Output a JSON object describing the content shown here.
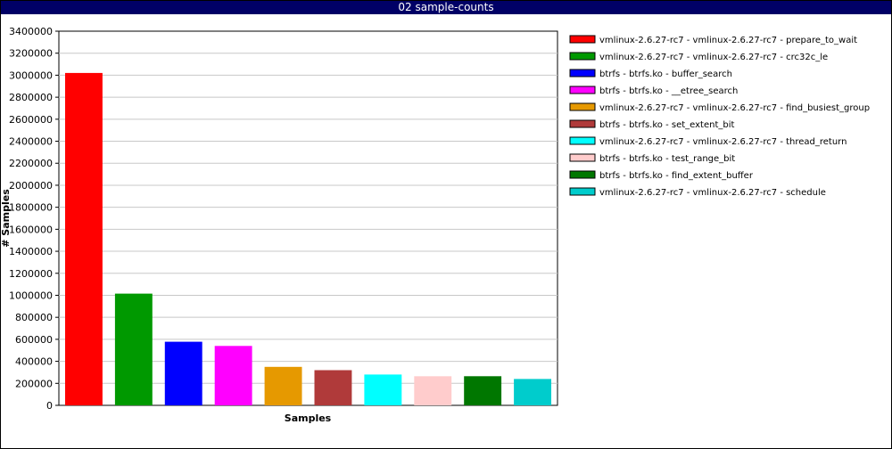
{
  "window": {
    "title": "02 sample-counts"
  },
  "chart_data": {
    "type": "bar",
    "title": "02 sample-counts",
    "xlabel": "Samples",
    "ylabel": "# Samples",
    "ylim": [
      0,
      3400000
    ],
    "yticks": [
      0,
      200000,
      400000,
      600000,
      800000,
      1000000,
      1200000,
      1400000,
      1600000,
      1800000,
      2000000,
      2200000,
      2400000,
      2600000,
      2800000,
      3000000,
      3200000,
      3400000
    ],
    "grid": true,
    "legend_position": "right",
    "series": [
      {
        "name": "vmlinux-2.6.27-rc7 - vmlinux-2.6.27-rc7 - prepare_to_wait",
        "value": 3020000,
        "color": "#ff0000"
      },
      {
        "name": "vmlinux-2.6.27-rc7 - vmlinux-2.6.27-rc7 - crc32c_le",
        "value": 1015000,
        "color": "#009900"
      },
      {
        "name": "btrfs - btrfs.ko - buffer_search",
        "value": 578000,
        "color": "#0000ff"
      },
      {
        "name": "btrfs - btrfs.ko - __etree_search",
        "value": 540000,
        "color": "#ff00ff"
      },
      {
        "name": "vmlinux-2.6.27-rc7 - vmlinux-2.6.27-rc7 - find_busiest_group",
        "value": 350000,
        "color": "#e69900"
      },
      {
        "name": "btrfs - btrfs.ko - set_extent_bit",
        "value": 320000,
        "color": "#b03a3a"
      },
      {
        "name": "vmlinux-2.6.27-rc7 - vmlinux-2.6.27-rc7 - thread_return",
        "value": 280000,
        "color": "#00ffff"
      },
      {
        "name": "btrfs - btrfs.ko - test_range_bit",
        "value": 265000,
        "color": "#ffcccc"
      },
      {
        "name": "btrfs - btrfs.ko - find_extent_buffer",
        "value": 265000,
        "color": "#007700"
      },
      {
        "name": "vmlinux-2.6.27-rc7 - vmlinux-2.6.27-rc7 - schedule",
        "value": 240000,
        "color": "#00cccc"
      }
    ]
  }
}
